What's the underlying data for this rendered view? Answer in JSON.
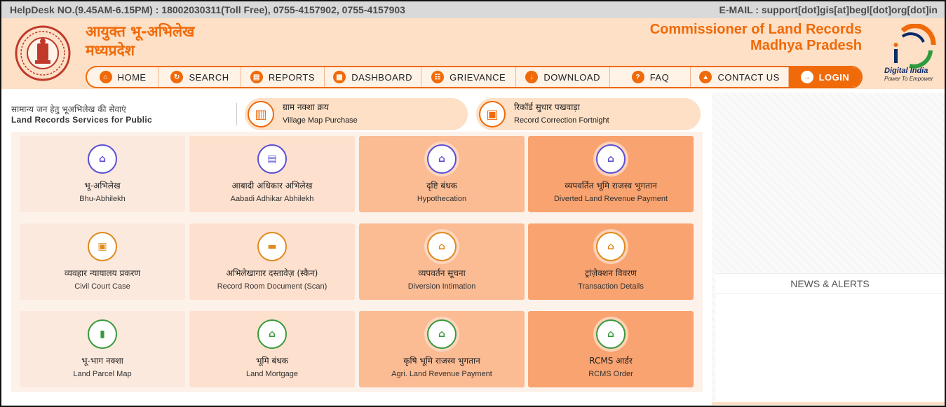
{
  "topbar": {
    "helpdesk": "HelpDesk NO.(9.45AM-6.15PM) : 18002030311(Toll Free), 0755-4157902, 0755-4157903",
    "email": "E-MAIL : support[dot]gis[at]begl[dot]org[dot]in"
  },
  "header": {
    "hindi_title_line1": "आयुक्त भू-अभिलेख",
    "hindi_title_line2": "मध्यप्रदेश",
    "english_title_line1": "Commissioner of Land Records",
    "english_title_line2": "Madhya Pradesh",
    "digital_india": "Digital India",
    "digital_india_tagline": "Power To Empower"
  },
  "nav": {
    "items": [
      {
        "label": "HOME",
        "icon": "home-icon"
      },
      {
        "label": "SEARCH",
        "icon": "refresh-icon"
      },
      {
        "label": "REPORTS",
        "icon": "document-icon"
      },
      {
        "label": "DASHBOARD",
        "icon": "dashboard-icon"
      },
      {
        "label": "GRIEVANCE",
        "icon": "chat-icon"
      },
      {
        "label": "DOWNLOAD",
        "icon": "download-icon"
      },
      {
        "label": "FAQ",
        "icon": "faq-icon"
      },
      {
        "label": "CONTACT US",
        "icon": "location-icon"
      },
      {
        "label": "LOGIN",
        "icon": "login-icon"
      }
    ]
  },
  "services": {
    "label_hindi": "सामान्य जन हेतु भूअभिलेख की सेवाएं",
    "label_english": "Land Records Services for Public"
  },
  "pills": [
    {
      "hindi": "ग्राम नक्शा क्रय",
      "english": "Village Map Purchase",
      "icon": "map-icon"
    },
    {
      "hindi": "रिकॉर्ड सुधार पखवाड़ा",
      "english": "Record Correction Fortnight",
      "icon": "building-icon"
    }
  ],
  "tiles": [
    {
      "hindi": "भू-अभिलेख",
      "english": "Bhu-Abhilekh",
      "icon": "home-icon",
      "color": "#5a4fd6"
    },
    {
      "hindi": "आबादी अधिकार अभिलेख",
      "english": "Aabadi Adhikar Abhilekh",
      "icon": "calendar-icon",
      "color": "#5a4fd6"
    },
    {
      "hindi": "दृष्टि बंधक",
      "english": "Hypothecation",
      "icon": "home-icon",
      "color": "#5a4fd6"
    },
    {
      "hindi": "व्यपवर्तित भूमि राजस्व भुगतान",
      "english": "Diverted Land Revenue Payment",
      "icon": "home-icon",
      "color": "#5a4fd6"
    },
    {
      "hindi": "व्यवहार न्यायालय प्रकरण",
      "english": "Civil Court Case",
      "icon": "building-icon",
      "color": "#e08a1e"
    },
    {
      "hindi": "अभिलेखागार दस्तावेज़ (स्कैन)",
      "english": "Record Room Document (Scan)",
      "icon": "folder-icon",
      "color": "#e08a1e"
    },
    {
      "hindi": "व्यपवर्तन सूचना",
      "english": "Diversion Intimation",
      "icon": "home-icon",
      "color": "#e08a1e"
    },
    {
      "hindi": "ट्रांज़ेक्शन विवरण",
      "english": "Transaction Details",
      "icon": "home-icon",
      "color": "#e08a1e"
    },
    {
      "hindi": "भू-भाग नक्शा",
      "english": "Land Parcel Map",
      "icon": "book-icon",
      "color": "#3a9a3a"
    },
    {
      "hindi": "भूमि बंधक",
      "english": "Land Mortgage",
      "icon": "home-icon",
      "color": "#3a9a3a"
    },
    {
      "hindi": "कृषि भूमि राजस्व भुगतान",
      "english": "Agri. Land Revenue Payment",
      "icon": "home-icon",
      "color": "#3a9a3a"
    },
    {
      "hindi": "RCMS आर्डर",
      "english": "RCMS Order",
      "icon": "home-icon",
      "color": "#3a9a3a"
    }
  ],
  "news": {
    "title": "NEWS & ALERTS"
  },
  "colors": {
    "accent": "#f06a0a",
    "header_bg": "#fde0c6"
  }
}
